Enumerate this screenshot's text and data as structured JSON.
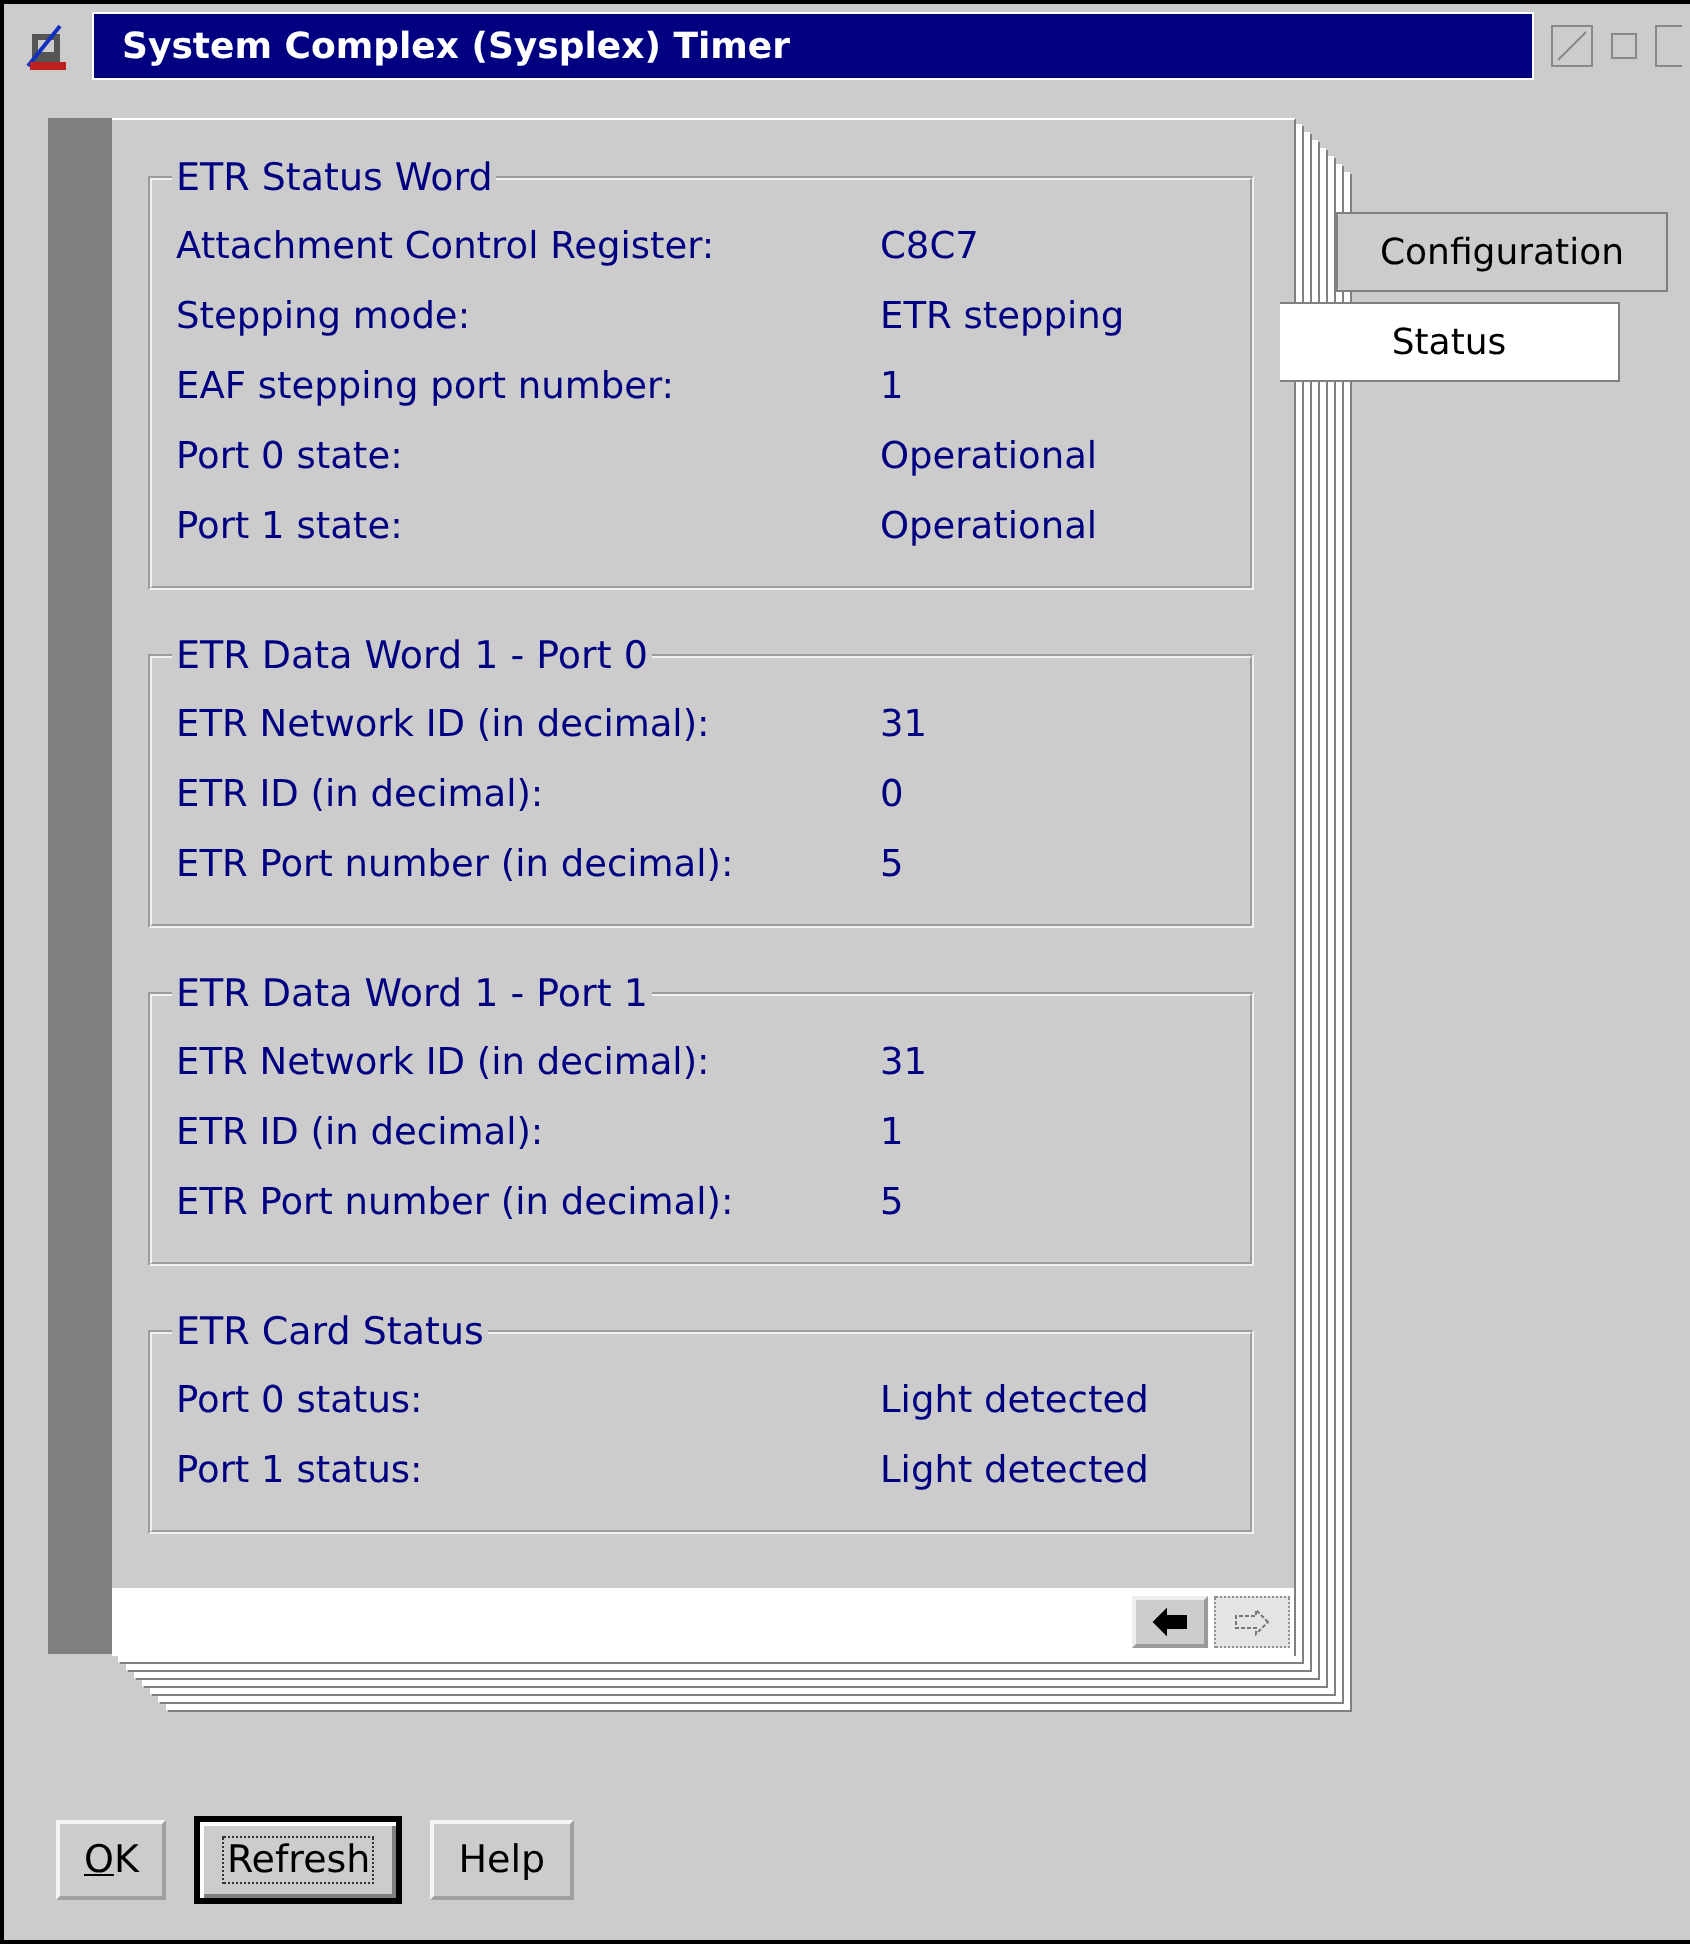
{
  "window": {
    "title": "System Complex (Sysplex) Timer"
  },
  "tabs": [
    {
      "label": "Configuration",
      "selected": false
    },
    {
      "label": "Status",
      "selected": true
    }
  ],
  "groups": [
    {
      "title": "ETR Status Word",
      "rows": [
        {
          "label": "Attachment Control Register:",
          "value": "C8C7"
        },
        {
          "label": "Stepping mode:",
          "value": "ETR stepping"
        },
        {
          "label": "EAF stepping port number:",
          "value": "1"
        },
        {
          "label": "Port 0 state:",
          "value": "Operational"
        },
        {
          "label": "Port 1 state:",
          "value": "Operational"
        }
      ]
    },
    {
      "title": "ETR Data Word 1 - Port 0",
      "rows": [
        {
          "label": "ETR Network ID (in decimal):",
          "value": "31"
        },
        {
          "label": "ETR ID (in decimal):",
          "value": "0"
        },
        {
          "label": "ETR Port number (in decimal):",
          "value": "5"
        }
      ]
    },
    {
      "title": "ETR Data Word 1 - Port 1",
      "rows": [
        {
          "label": "ETR Network ID (in decimal):",
          "value": "31"
        },
        {
          "label": "ETR ID (in decimal):",
          "value": "1"
        },
        {
          "label": "ETR Port number (in decimal):",
          "value": "5"
        }
      ]
    },
    {
      "title": "ETR Card Status",
      "rows": [
        {
          "label": "Port 0 status:",
          "value": "Light detected"
        },
        {
          "label": "Port 1 status:",
          "value": "Light detected"
        }
      ]
    }
  ],
  "page_arrows": [
    {
      "kind": "back",
      "disabled": false
    },
    {
      "kind": "forward",
      "disabled": true
    }
  ],
  "buttons": [
    {
      "label": "OK",
      "default": false,
      "mnemonic_underlined": true
    },
    {
      "label": "Refresh",
      "default": true,
      "mnemonic_underlined": false
    },
    {
      "label": "Help",
      "default": false,
      "mnemonic_underlined": false
    }
  ]
}
